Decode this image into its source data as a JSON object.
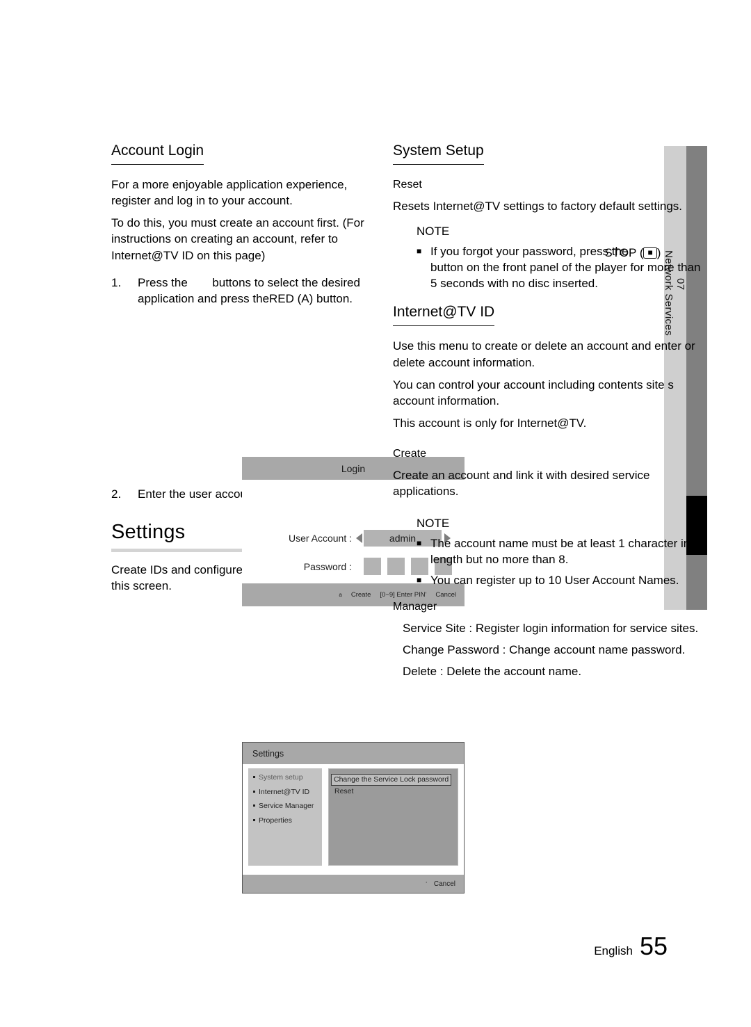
{
  "chapter_tab": {
    "number": "07",
    "label": "Network Services"
  },
  "left_column": {
    "account_login": {
      "heading": "Account Login",
      "paragraphs": [
        "For a more enjoyable application experience, register and log in to your account.",
        "To do this, you must create an account first. (For instructions on creating an account, refer to Internet@TV ID on this page)"
      ],
      "steps": [
        {
          "number": "1.",
          "text_part1": "Press the ",
          "text_part2": "buttons to select the desired application and press the",
          "text_part3": "RED (A)",
          "text_part4": " button."
        },
        {
          "number": "2.",
          "text": "Enter the user account and password."
        }
      ]
    },
    "login_screenshot": {
      "title": "Login",
      "user_account_label": "User Account :",
      "user_account_value": "admin",
      "password_label": "Password :",
      "password_boxes": 4,
      "footer": {
        "create_key": "a",
        "create_label": "Create",
        "pin_label": "[0~9] Enter PIN'",
        "cancel_label": "Cancel"
      }
    },
    "settings": {
      "heading": "Settings",
      "description": "Create IDs and configure Internet@TV settings on this screen."
    },
    "settings_screenshot": {
      "title": "Settings",
      "nav_items": [
        "System setup",
        "Internet@TV ID",
        "Service Manager",
        "Properties"
      ],
      "panel_items": [
        "Change the Service Lock password",
        "Reset"
      ],
      "footer": {
        "cancel_key": "'",
        "cancel_label": "Cancel"
      }
    }
  },
  "right_column": {
    "system_setup": {
      "heading": "System Setup",
      "subheading": "Reset",
      "description": "Resets Internet@TV settings to factory default settings.",
      "note": {
        "title": "NOTE",
        "items_prefix": "If you forgot your password, press the",
        "items_overlap": "STOP",
        "key_glyph": "■",
        "items_suffix": "button on the front panel of the player for more than 5 seconds with no disc inserted."
      }
    },
    "internet_tv_id": {
      "heading": "Internet@TV ID",
      "paragraphs": [
        "Use this menu to create or delete an account and enter or delete account information.",
        "You can control your account including contents site s account information.",
        "This account is only for Internet@TV."
      ],
      "create": {
        "subheading": "Create",
        "description": "Create an account and link it with desired service applications."
      },
      "note": {
        "title": "NOTE",
        "items": [
          "The account name must be at least 1 character in length but no more than 8.",
          "You can register up to 10 User Account Names."
        ]
      },
      "manager": {
        "subheading": "Manager",
        "entries": [
          "Service Site  : Register login information for service sites.",
          "Change Password  : Change account name password.",
          "Delete : Delete the account name."
        ]
      }
    }
  },
  "footer": {
    "language": "English",
    "page_number": "55"
  }
}
